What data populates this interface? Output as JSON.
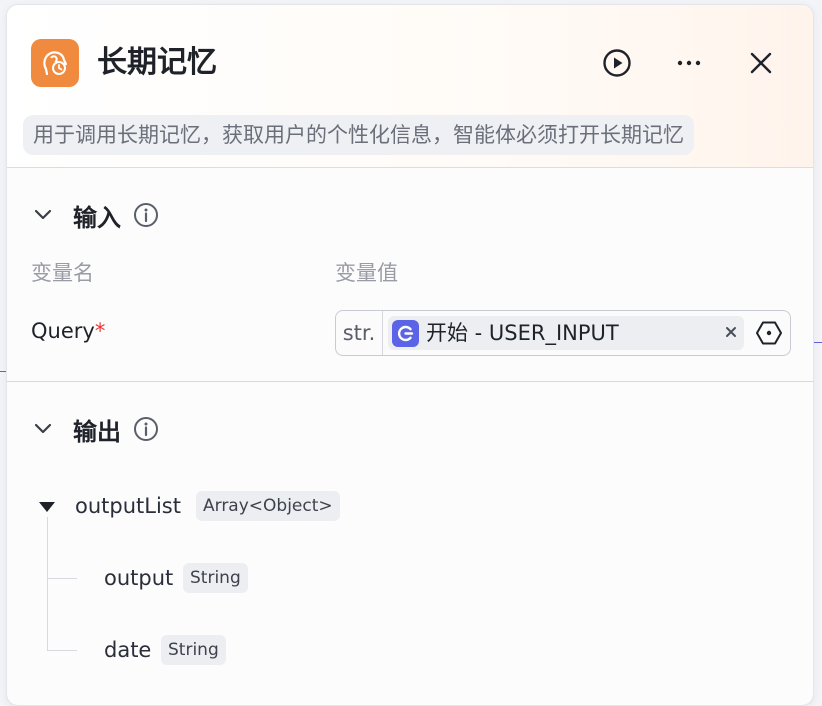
{
  "node": {
    "title": "长期记忆",
    "description": "用于调用长期记忆，获取用户的个性化信息，智能体必须打开长期记忆",
    "icon": "memory-clock-icon",
    "accent_color": "#ef8a3e"
  },
  "header_actions": [
    {
      "icon": "play-circle-icon"
    },
    {
      "icon": "more-dots-icon"
    },
    {
      "icon": "close-icon"
    }
  ],
  "input_section": {
    "label": "输入",
    "col_name": "变量名",
    "col_value": "变量值",
    "params": [
      {
        "name": "Query",
        "required_mark": "*",
        "type_label": "str.",
        "ref_text": "开始 - USER_INPUT",
        "ref_icon_color": "#5b63e6"
      }
    ]
  },
  "output_section": {
    "label": "输出",
    "root": {
      "name": "outputList",
      "type": "Array<Object>"
    },
    "children": [
      {
        "name": "output",
        "type": "String"
      },
      {
        "name": "date",
        "type": "String"
      }
    ]
  }
}
